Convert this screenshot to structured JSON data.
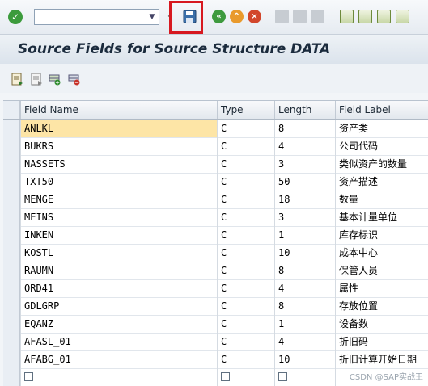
{
  "toolbar": {
    "command_field_value": "",
    "icons": [
      "enter-icon",
      "dropdown-icon",
      "save-icon",
      "back-icon",
      "exit-icon",
      "cancel-icon",
      "print-icon",
      "find-icon",
      "find-next-icon",
      "first-page-icon",
      "previous-page-icon",
      "next-page-icon",
      "last-page-icon"
    ],
    "arrow_label": "«"
  },
  "title": "Source Fields for Source Structure DATA",
  "app_toolbar_icons": [
    "details-icon",
    "display-icon",
    "insert-row-icon",
    "delete-row-icon"
  ],
  "table": {
    "columns": [
      "Field Name",
      "Type",
      "Length",
      "Field Label"
    ],
    "rows": [
      {
        "name": "ANLKL",
        "type": "C",
        "length": "8",
        "label": "资产类"
      },
      {
        "name": "BUKRS",
        "type": "C",
        "length": "4",
        "label": "公司代码"
      },
      {
        "name": "NASSETS",
        "type": "C",
        "length": "3",
        "label": "类似资产的数量"
      },
      {
        "name": "TXT50",
        "type": "C",
        "length": "50",
        "label": "资产描述"
      },
      {
        "name": "MENGE",
        "type": "C",
        "length": "18",
        "label": "数量"
      },
      {
        "name": "MEINS",
        "type": "C",
        "length": "3",
        "label": "基本计量单位"
      },
      {
        "name": "INKEN",
        "type": "C",
        "length": "1",
        "label": "库存标识"
      },
      {
        "name": "KOSTL",
        "type": "C",
        "length": "10",
        "label": "成本中心"
      },
      {
        "name": "RAUMN",
        "type": "C",
        "length": "8",
        "label": "保管人员"
      },
      {
        "name": "ORD41",
        "type": "C",
        "length": "4",
        "label": "属性"
      },
      {
        "name": "GDLGRP",
        "type": "C",
        "length": "8",
        "label": "存放位置"
      },
      {
        "name": "EQANZ",
        "type": "C",
        "length": "1",
        "label": "设备数"
      },
      {
        "name": "AFASL_01",
        "type": "C",
        "length": "4",
        "label": "折旧码"
      },
      {
        "name": "AFABG_01",
        "type": "C",
        "length": "10",
        "label": "折旧计算开始日期"
      }
    ]
  },
  "watermark": "CSDN @SAP实战王",
  "colors": {
    "highlight_box": "#d71920",
    "selected_cell": "#fde5a6",
    "title_text": "#1b2b3d"
  }
}
